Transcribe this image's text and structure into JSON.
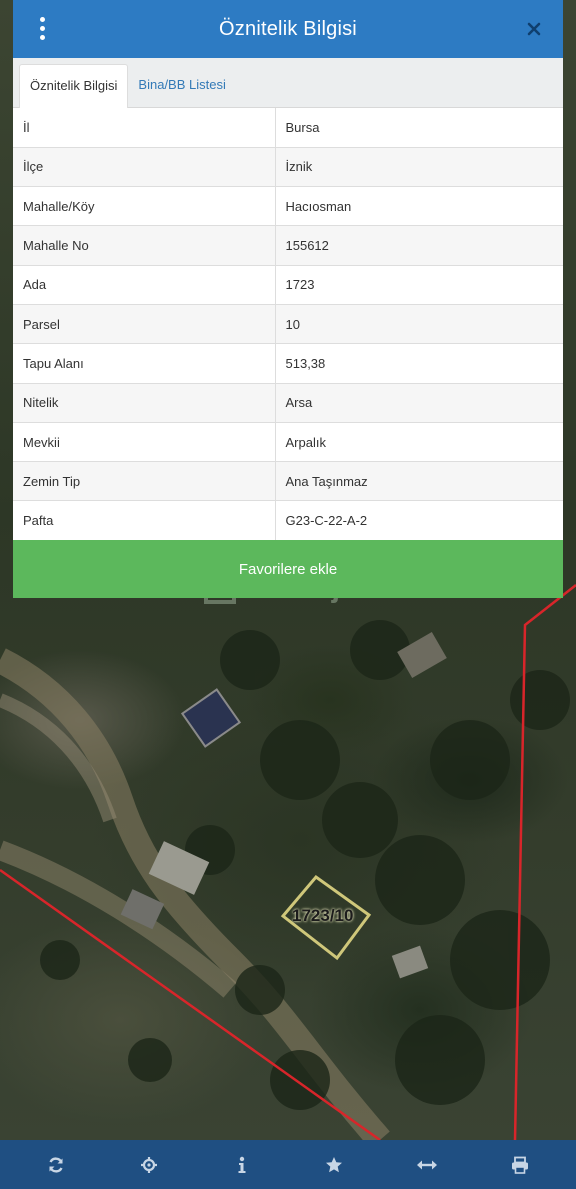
{
  "header": {
    "title": "Öznitelik Bilgisi"
  },
  "tabs": [
    {
      "label": "Öznitelik Bilgisi",
      "active": true
    },
    {
      "label": "Bina/BB Listesi",
      "active": false
    }
  ],
  "attributes": [
    {
      "key": "İl",
      "value": "Bursa"
    },
    {
      "key": "İlçe",
      "value": "İznik"
    },
    {
      "key": "Mahalle/Köy",
      "value": "Hacıosman"
    },
    {
      "key": "Mahalle No",
      "value": "155612"
    },
    {
      "key": "Ada",
      "value": "1723"
    },
    {
      "key": "Parsel",
      "value": "10"
    },
    {
      "key": "Tapu Alanı",
      "value": "513,38"
    },
    {
      "key": "Nitelik",
      "value": "Arsa"
    },
    {
      "key": "Mevkii",
      "value": "Arpalık"
    },
    {
      "key": "Zemin Tip",
      "value": "Ana Taşınmaz"
    },
    {
      "key": "Pafta",
      "value": "G23-C-22-A-2"
    }
  ],
  "favorite_button": {
    "label": "Favorilere ekle"
  },
  "watermark": {
    "text": "emlakjet"
  },
  "map": {
    "parcel_label": "1723/10"
  },
  "toolbar": {
    "icons": [
      "refresh-icon",
      "locate-icon",
      "info-icon",
      "star-icon",
      "measure-icon",
      "print-icon"
    ]
  },
  "colors": {
    "header": "#2d7bc3",
    "favorite_button": "#5cb85c",
    "toolbar": "#1f4f82",
    "boundary": "#d8252a",
    "parcel": "#cfc77a"
  }
}
